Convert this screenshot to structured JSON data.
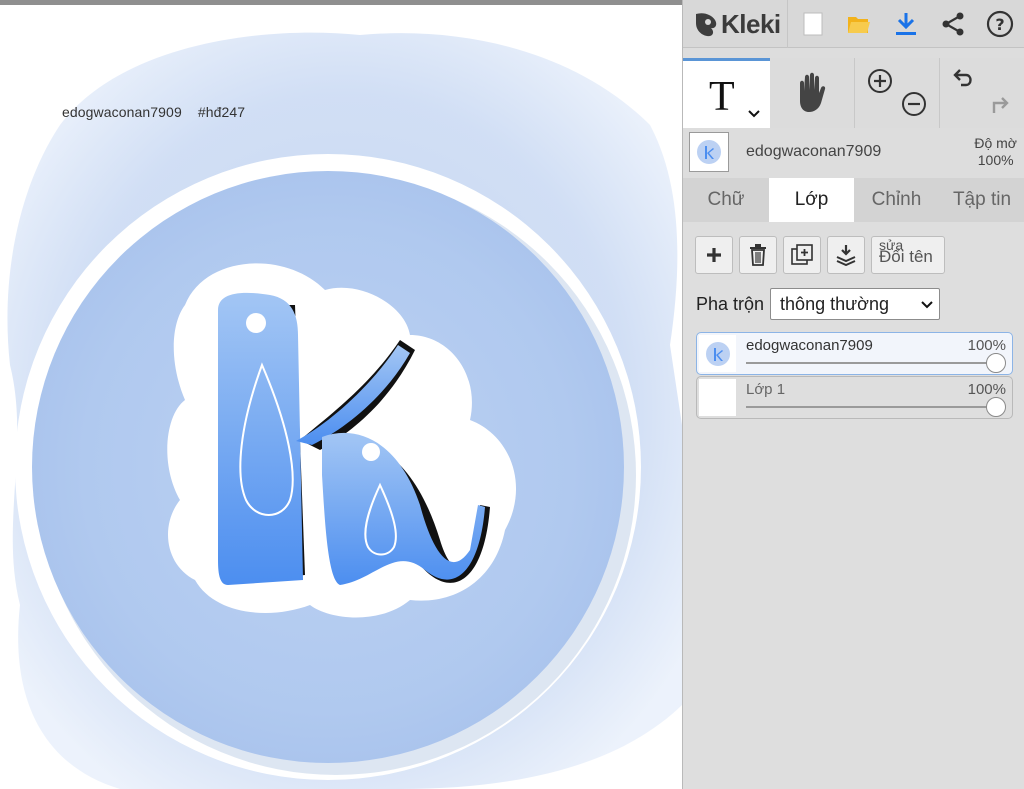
{
  "app": {
    "name": "Kleki"
  },
  "canvas": {
    "caption_user": "edogwaconan7909",
    "caption_tag": "#hđ247"
  },
  "top_bar": {
    "buttons": [
      {
        "icon": "new-file-icon"
      },
      {
        "icon": "open-folder-icon"
      },
      {
        "icon": "download-icon"
      },
      {
        "icon": "share-icon"
      },
      {
        "icon": "help-icon"
      }
    ]
  },
  "tools": {
    "active": "text",
    "text_glyph": "T"
  },
  "layer_header": {
    "name": "edogwaconan7909",
    "opacity_label": "Độ mờ",
    "opacity_value": "100%"
  },
  "tabs": [
    {
      "label": "Chữ",
      "active": false
    },
    {
      "label": "Lớp",
      "active": true
    },
    {
      "label": "Chỉnh",
      "active": false
    },
    {
      "label": "Tập tin",
      "active": false
    }
  ],
  "layer_panel": {
    "rename_top": "sửa",
    "rename_label": "Đổi tên",
    "blend_label": "Pha trộn",
    "blend_value": "thông thường",
    "layers": [
      {
        "name": "edogwaconan7909",
        "opacity": "100%",
        "opacity_value": 1.0,
        "selected": true
      },
      {
        "name": "Lớp 1",
        "opacity": "100%",
        "opacity_value": 1.0,
        "selected": false
      }
    ]
  },
  "colors": {
    "accent": "#5a95d6",
    "download": "#1a73e8",
    "folder": "#f2b21b",
    "logo_blue": "#5b96e8"
  }
}
